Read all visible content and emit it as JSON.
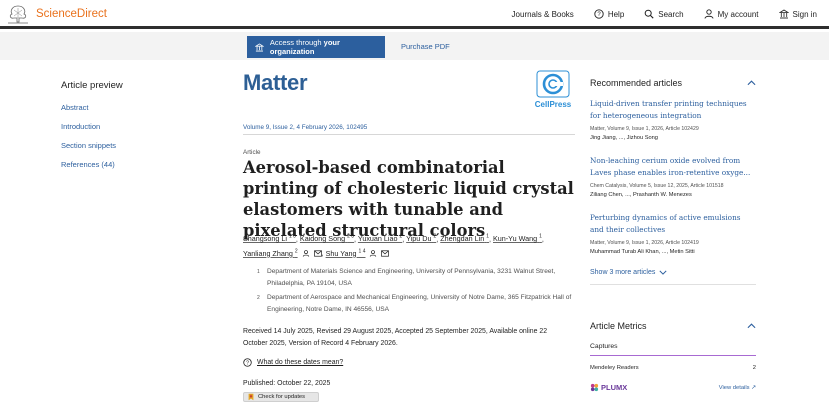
{
  "header": {
    "brand": "ScienceDirect",
    "nav": {
      "journals": "Journals & Books",
      "help": "Help",
      "search": "Search",
      "account": "My account",
      "signin": "Sign in"
    }
  },
  "access": {
    "button_prefix": "Access through ",
    "button_bold": "your organization",
    "purchase": "Purchase PDF"
  },
  "preview": {
    "title": "Article preview",
    "links": [
      "Abstract",
      "Introduction",
      "Section snippets",
      "References (44)"
    ]
  },
  "article": {
    "journal": "Matter",
    "publisher_logo": "CellPress",
    "journal_ref": "Volume 9, Issue 2, 4 February 2026, 102495",
    "type": "Article",
    "title": "Aerosol-based combinatorial printing of cholesteric liquid crystal elastomers with tunable and pixelated structural colors",
    "authors": [
      {
        "name": "Shangsong Li",
        "sup": "1 3"
      },
      {
        "name": "Kaidong Song",
        "sup": "2 3"
      },
      {
        "name": "Yuxuan Liao",
        "sup": "2"
      },
      {
        "name": "Yipu Du",
        "sup": "2"
      },
      {
        "name": "Zhengdan Lin",
        "sup": "1"
      },
      {
        "name": "Kun-Yu Wang",
        "sup": "1"
      },
      {
        "name": "Yanliang Zhang",
        "sup": "2"
      },
      {
        "name": "Shu Yang",
        "sup": "1 4"
      }
    ],
    "affiliations": [
      {
        "sup": "1",
        "text": "Department of Materials Science and Engineering, University of Pennsylvania, 3231 Walnut Street, Philadelphia, PA 19104, USA"
      },
      {
        "sup": "2",
        "text": "Department of Aerospace and Mechanical Engineering, University of Notre Dame, 365 Fitzpatrick Hall of Engineering, Notre Dame, IN 46556, USA"
      }
    ],
    "dates": "Received 14 July 2025, Revised 29 August 2025, Accepted 25 September 2025, Available online 22 October 2025, Version of Record 4 February 2026.",
    "what_dates": "What do these dates mean?",
    "published": "Published: October 22, 2025",
    "check_updates": "Check for updates"
  },
  "recommended": {
    "title": "Recommended articles",
    "items": [
      {
        "title": "Liquid-driven transfer printing techniques for heterogeneous integration",
        "meta": "Matter, Volume 9, Issue 1, 2026, Article 102429",
        "authors": "Jing Jiang, ..., Jizhou Song"
      },
      {
        "title": "Non-leaching cerium oxide evolved from Laves phase enables iron-retentive oxyge...",
        "meta": "Chem Catalysis, Volume 5, Issue 12, 2025, Article 101518",
        "authors": "Ziliang Chen, ..., Prashanth W. Menezes"
      },
      {
        "title": "Perturbing dynamics of active emulsions and their collectives",
        "meta": "Matter, Volume 9, Issue 1, 2026, Article 102419",
        "authors": "Muhammad Turab Ali Khan, ..., Metin Sitti"
      }
    ],
    "show_more": "Show 3 more articles"
  },
  "metrics": {
    "title": "Article Metrics",
    "captures": "Captures",
    "mendeley_label": "Mendeley Readers",
    "mendeley_value": "2",
    "plumx": "PLUMX",
    "view_details": "View details"
  },
  "colors": {
    "brand_orange": "#e9711c",
    "link_blue": "#2c5f9e",
    "accent_purple": "#a86ad2"
  }
}
